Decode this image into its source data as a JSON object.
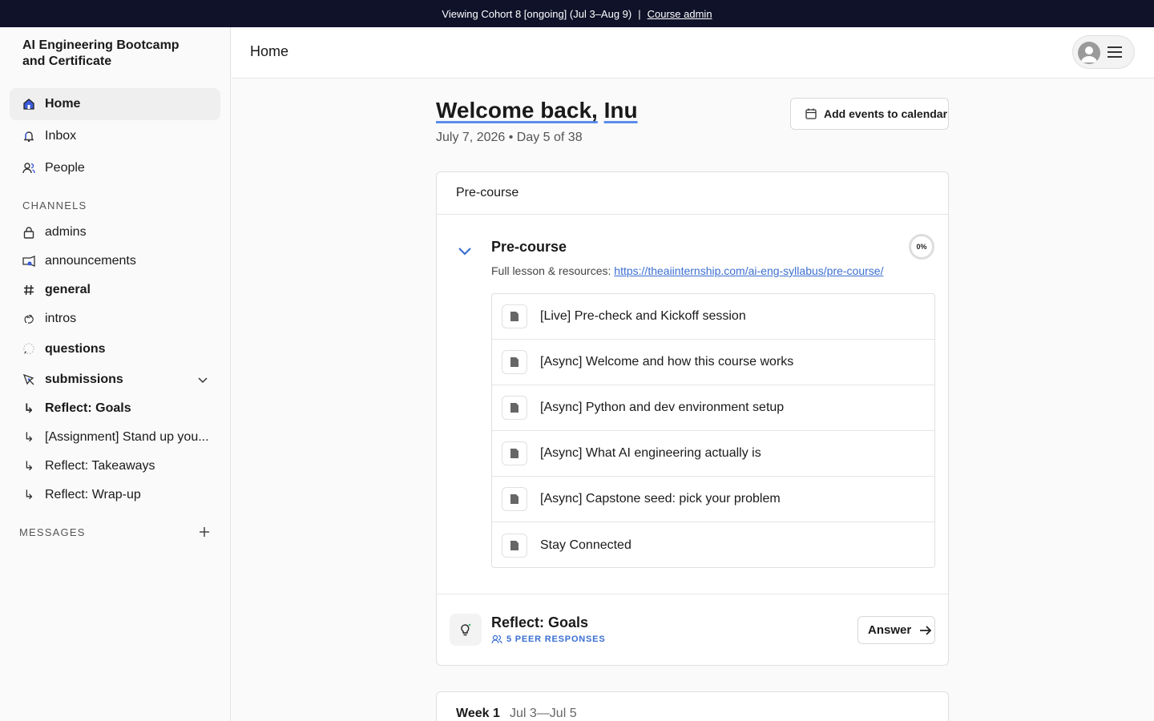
{
  "banner": {
    "text": "Viewing Cohort 8 [ongoing] (Jul 3–Aug 9)",
    "separator": "|",
    "link": "Course admin"
  },
  "sidebar": {
    "brand": "AI Engineering Bootcamp and Certificate",
    "nav": [
      {
        "label": "Home",
        "icon": "home-icon",
        "active": true
      },
      {
        "label": "Inbox",
        "icon": "bell-icon"
      },
      {
        "label": "People",
        "icon": "people-icon"
      }
    ],
    "channels_label": "CHANNELS",
    "channels": [
      {
        "label": "admins",
        "icon": "lock-icon"
      },
      {
        "label": "announcements",
        "icon": "megaphone-icon"
      },
      {
        "label": "general",
        "icon": "hash-icon"
      },
      {
        "label": "intros",
        "icon": "wave-icon"
      },
      {
        "label": "questions",
        "icon": "chat-icon"
      },
      {
        "label": "submissions",
        "icon": "pen-icon"
      }
    ],
    "sub_items": [
      {
        "label": "Reflect: Goals"
      },
      {
        "label": "[Assignment] Stand up you..."
      },
      {
        "label": "Reflect: Takeaways"
      },
      {
        "label": "Reflect: Wrap-up"
      }
    ],
    "sub_arrow": "↳",
    "messages_label": "MESSAGES"
  },
  "header": {
    "title": "Home"
  },
  "main": {
    "welcome_prefix": "Welcome back,",
    "welcome_name": "Inu",
    "date": "July 7, 2026 • Day 5 of 38",
    "calendar_button": "Add events to calendar",
    "card_title": "Pre-course",
    "section": {
      "title": "Pre-course",
      "progress": "0%",
      "resources_label": "Full lesson & resources:",
      "resources_link": "https://theaiinternship.com/ai-eng-syllabus/pre-course/",
      "lessons": [
        "[Live] Pre-check and Kickoff session",
        "[Async] Welcome and how this course works",
        "[Async] Python and dev environment setup",
        "[Async] What AI engineering actually is",
        "[Async] Capstone seed: pick your problem",
        "Stay Connected"
      ]
    },
    "reflect": {
      "title": "Reflect: Goals",
      "peer": "5 PEER RESPONSES",
      "button": "Answer"
    },
    "week": {
      "label": "Week 1",
      "range": "Jul 3—Jul 5"
    }
  },
  "colors": {
    "banner_bg": "#0f1229",
    "link": "#3b6fd1",
    "underline": "#5b8dea"
  }
}
